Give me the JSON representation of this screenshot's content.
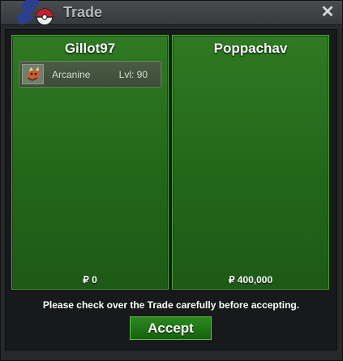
{
  "window": {
    "title": "Trade",
    "close_icon": "close-icon"
  },
  "trade": {
    "left": {
      "name": "Gillot97",
      "items": [
        {
          "name": "Arcanine",
          "level": "Lvl: 90",
          "icon": "arcanine-icon"
        }
      ],
      "money": "₽ 0"
    },
    "right": {
      "name": "Poppachav",
      "items": [],
      "money": "₽ 400,000"
    },
    "notice": "Please check over the Trade carefully before accepting.",
    "accept_label": "Accept"
  },
  "colors": {
    "panel_green": "#23661a",
    "panel_border": "#4fa53a",
    "button_green": "#2a8a1e"
  }
}
